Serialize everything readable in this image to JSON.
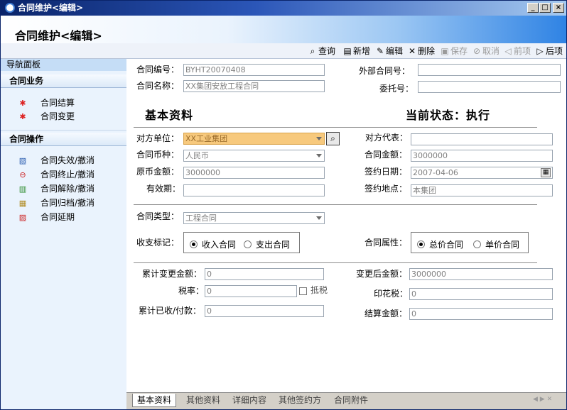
{
  "window": {
    "title": "合同维护<编辑>",
    "minimize": "_",
    "maximize": "□",
    "close": "×"
  },
  "banner": {
    "title": "合同维护<编辑>"
  },
  "toolbar": [
    {
      "label": "查询",
      "icon": "search-icon",
      "glyph": "🔍",
      "enabled": true
    },
    {
      "label": "新增",
      "icon": "new-icon",
      "glyph": "▤",
      "enabled": true
    },
    {
      "label": "编辑",
      "icon": "edit-icon",
      "glyph": "✎",
      "enabled": true
    },
    {
      "label": "删除",
      "icon": "delete-icon",
      "glyph": "✕",
      "enabled": true
    },
    {
      "label": "保存",
      "icon": "save-icon",
      "glyph": "▣",
      "enabled": false
    },
    {
      "label": "取消",
      "icon": "cancel-icon",
      "glyph": "⊘",
      "enabled": false
    },
    {
      "label": "前项",
      "icon": "prev-icon",
      "glyph": "◁",
      "enabled": false
    },
    {
      "label": "后项",
      "icon": "next-icon",
      "glyph": "▷",
      "enabled": true
    }
  ],
  "nav": {
    "header": "导航面板",
    "section1": {
      "title": "合同业务",
      "items": [
        "合同结算",
        "合同变更"
      ]
    },
    "section2": {
      "title": "合同操作",
      "items": [
        "合同失效/撤消",
        "合同终止/撤消",
        "合同解除/撤消",
        "合同归档/撤消",
        "合同延期"
      ]
    }
  },
  "form": {
    "contract_no": {
      "label": "合同编号：",
      "value": "BYHT20070408"
    },
    "contract_name": {
      "label": "合同名称：",
      "value": "XX集团安放工程合同"
    },
    "external_no": {
      "label": "外部合同号：",
      "value": ""
    },
    "entrust_no": {
      "label": "委托号：",
      "value": ""
    },
    "basic_title": "基本资料",
    "status_title": "当前状态：执行",
    "party": {
      "label": "对方单位：",
      "value": "XX工业集团"
    },
    "party_rep": {
      "label": "对方代表：",
      "value": ""
    },
    "currency": {
      "label": "合同币种：",
      "value": "人民币"
    },
    "amount": {
      "label": "合同金额：",
      "value": "3000000"
    },
    "orig_amount": {
      "label": "原币金额：",
      "value": "3000000"
    },
    "sign_date": {
      "label": "签约日期：",
      "value": "2007-04-06"
    },
    "validity": {
      "label": "有效期：",
      "value": ""
    },
    "sign_place": {
      "label": "签约地点：",
      "value": "本集团"
    },
    "contract_type": {
      "label": "合同类型：",
      "value": "工程合同"
    },
    "income_flag": {
      "label": "收支标记：",
      "opt1": "收入合同",
      "opt2": "支出合同",
      "selected": "收入合同"
    },
    "contract_attr": {
      "label": "合同属性：",
      "opt1": "总价合同",
      "opt2": "单价合同",
      "selected": "总价合同"
    },
    "cum_change": {
      "label": "累计变更金额：",
      "value": "0"
    },
    "after_change": {
      "label": "变更后金额：",
      "value": "3000000"
    },
    "tax_rate": {
      "label": "税率：",
      "value": "0",
      "deduct_label": "抵税",
      "deduct_checked": false
    },
    "stamp_tax": {
      "label": "印花税：",
      "value": "0"
    },
    "cum_received": {
      "label": "累计已收/付款：",
      "value": "0"
    },
    "settle_amount": {
      "label": "结算金额：",
      "value": "0"
    }
  },
  "tabs": [
    "基本资料",
    "其他资料",
    "详细内容",
    "其他签约方",
    "合同附件"
  ],
  "active_tab": "基本资料"
}
